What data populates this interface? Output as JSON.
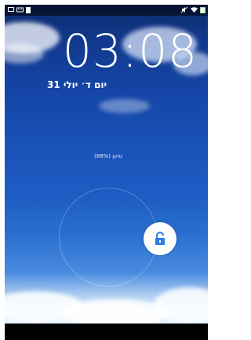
{
  "status_bar": {
    "left_icons": [
      "window-icon",
      "keyboard-icon",
      "sd-card-icon"
    ],
    "right_icons": [
      "mute-icon",
      "wifi-icon",
      "battery-icon"
    ]
  },
  "lock_screen": {
    "time": "03:08",
    "date": "יום ד׳ יולי 31",
    "battery_status": "טוען (88%)",
    "unlock_icon": "unlock-padlock-icon"
  },
  "colors": {
    "accent_unlock": "#2a7de1",
    "battery_icon": "#4caf50"
  }
}
